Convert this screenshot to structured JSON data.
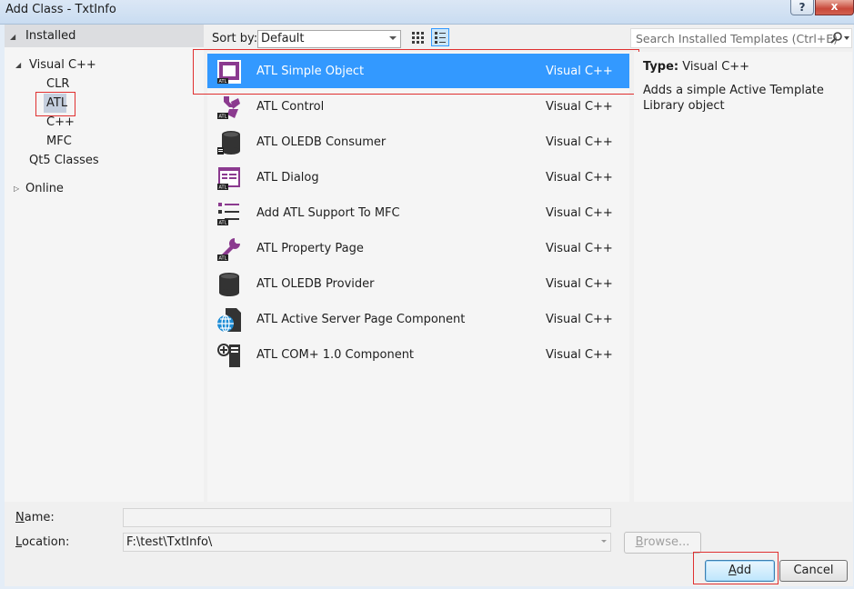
{
  "window": {
    "title": "Add Class - TxtInfo",
    "help_glyph": "?",
    "close_glyph": "x"
  },
  "tree": {
    "installed": "Installed",
    "visual_cpp": "Visual C++",
    "children": [
      "CLR",
      "ATL",
      "C++",
      "MFC"
    ],
    "qt": "Qt5 Classes",
    "online": "Online",
    "selected": "ATL"
  },
  "toolbar": {
    "sort_label": "Sort by:",
    "sort_value": "Default",
    "search_placeholder": "Search Installed Templates (Ctrl+E)"
  },
  "templates": [
    {
      "name": "ATL Simple Object",
      "lang": "Visual C++",
      "icon": "atl-simple-object-icon",
      "selected": true
    },
    {
      "name": "ATL Control",
      "lang": "Visual C++",
      "icon": "atl-control-icon"
    },
    {
      "name": "ATL OLEDB Consumer",
      "lang": "Visual C++",
      "icon": "database-consumer-icon"
    },
    {
      "name": "ATL Dialog",
      "lang": "Visual C++",
      "icon": "atl-dialog-icon"
    },
    {
      "name": "Add ATL Support To MFC",
      "lang": "Visual C++",
      "icon": "atl-mfc-support-icon"
    },
    {
      "name": "ATL Property Page",
      "lang": "Visual C++",
      "icon": "atl-property-page-icon"
    },
    {
      "name": "ATL OLEDB Provider",
      "lang": "Visual C++",
      "icon": "database-provider-icon"
    },
    {
      "name": "ATL Active Server Page Component",
      "lang": "Visual C++",
      "icon": "asp-globe-icon"
    },
    {
      "name": "ATL COM+ 1.0 Component",
      "lang": "Visual C++",
      "icon": "com-plus-icon"
    }
  ],
  "details": {
    "type_label": "Type:",
    "type_value": "Visual C++",
    "description": "Adds a simple Active Template Library object"
  },
  "form": {
    "name_label": "Name:",
    "name_value": "",
    "location_label": "Location:",
    "location_value": "F:\\test\\TxtInfo\\"
  },
  "buttons": {
    "browse": "Browse...",
    "add": "Add",
    "cancel": "Cancel"
  },
  "colors": {
    "selection": "#3399ff",
    "highlight_box": "#e03030",
    "atl_purple": "#8b3a8f"
  }
}
